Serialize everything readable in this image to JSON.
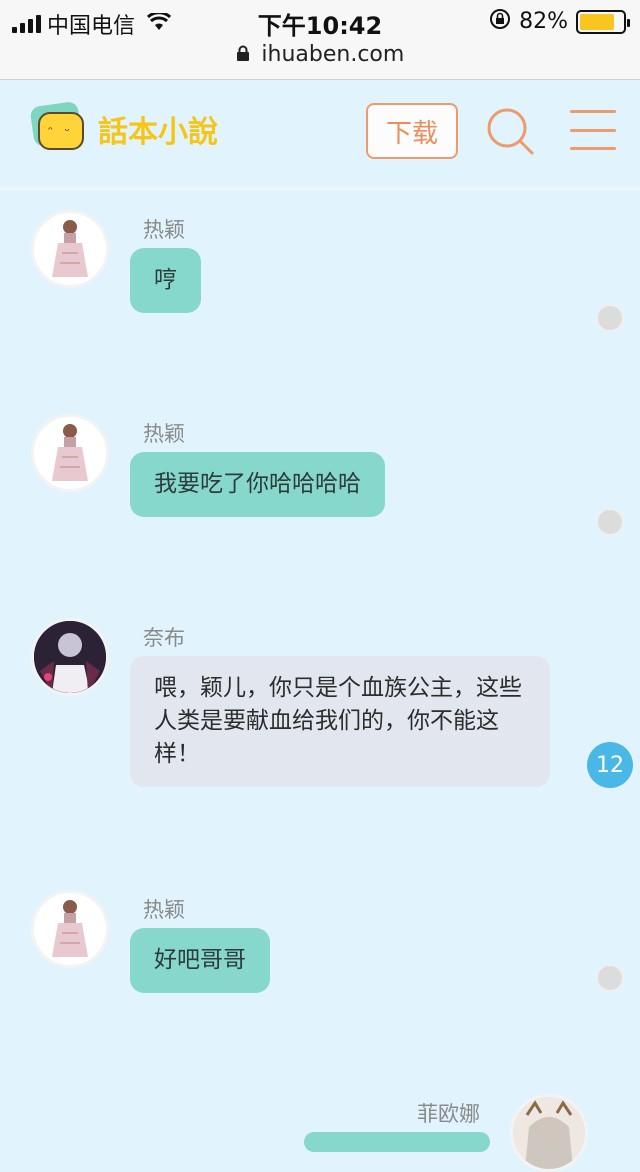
{
  "status_bar": {
    "carrier": "中国电信",
    "time": "下午10:42",
    "battery_percent": "82%",
    "battery_level": 0.82,
    "url": "ihuaben.com"
  },
  "header": {
    "logo_text": "話本小說",
    "download_label": "下载",
    "accent_color": "#ee9a6d"
  },
  "messages": [
    {
      "sender": "热颖",
      "text": "哼"
    },
    {
      "sender": "热颖",
      "text": "我要吃了你哈哈哈哈"
    },
    {
      "sender": "奈布",
      "text": "喂，颖儿，你只是个血族公主，这些人类是要献血给我们的，你不能这样！",
      "comment_count": "12"
    },
    {
      "sender": "热颖",
      "text": "好吧哥哥"
    },
    {
      "sender": "菲欧娜",
      "text": ""
    }
  ]
}
